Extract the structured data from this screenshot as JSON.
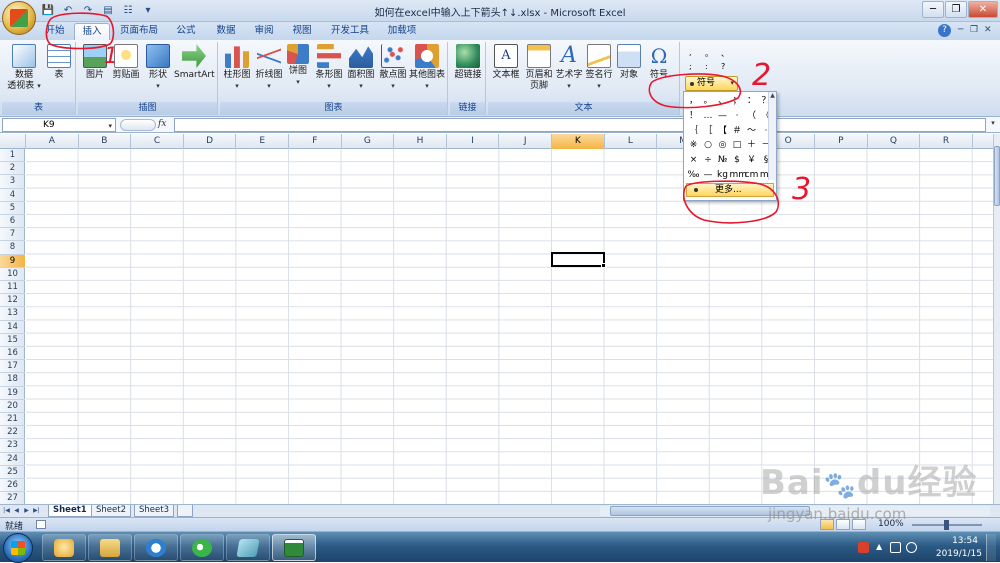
{
  "window": {
    "title": "如何在excel中输入上下箭头↑↓.xlsx - Microsoft Excel",
    "minimize": "─",
    "restore": "❐",
    "close": "✕",
    "quick_access": [
      "💾",
      "↶",
      "↷",
      "▤",
      "☷",
      "▾"
    ]
  },
  "tabs": [
    {
      "label": "开始",
      "active": false
    },
    {
      "label": "插入",
      "active": true
    },
    {
      "label": "页面布局",
      "active": false
    },
    {
      "label": "公式",
      "active": false
    },
    {
      "label": "数据",
      "active": false
    },
    {
      "label": "审阅",
      "active": false
    },
    {
      "label": "视图",
      "active": false
    },
    {
      "label": "开发工具",
      "active": false
    },
    {
      "label": "加载项",
      "active": false
    }
  ],
  "help_label": "?",
  "ribbon": {
    "groups": {
      "tables": "表",
      "illustrations": "插图",
      "charts": "图表",
      "links": "链接",
      "text": "文本"
    },
    "buttons": {
      "pivot_line1": "数据",
      "pivot_line2": "透视表",
      "table": "表",
      "picture": "图片",
      "clipart": "剪贴画",
      "shapes": "形状",
      "smartart": "SmartArt",
      "column": "柱形图",
      "line": "折线图",
      "pie": "饼图",
      "bar": "条形图",
      "area": "面积图",
      "scatter": "散点图",
      "other": "其他图表",
      "hyperlink": "超链接",
      "textbox": "文本框",
      "header_line1": "页眉和",
      "header_line2": "页脚",
      "wordart": "艺术字",
      "signature": "签名行",
      "object": "对象",
      "symbol": "符号"
    },
    "textbox_glyph": "A",
    "wordart_glyph": "A",
    "omega_glyph": "Ω",
    "dropdown_glyph": "▾"
  },
  "symbol_mini": [
    ",",
    "。",
    "、",
    ";",
    ":",
    "?"
  ],
  "symbol_button": {
    "label": "符号"
  },
  "symbol_panel": {
    "rows": [
      [
        "，",
        "。",
        "、",
        "；",
        "：",
        "？"
      ],
      [
        "！",
        "…",
        "—",
        "·",
        "（",
        "《"
      ],
      [
        "｛",
        "［",
        "【",
        "＃",
        "～",
        "·"
      ],
      [
        "※",
        "○",
        "◎",
        "□",
        "＋",
        "－"
      ],
      [
        "×",
        "÷",
        "№",
        "$",
        "￥",
        "§"
      ],
      [
        "‰",
        "—",
        "kg",
        "mm",
        "cm",
        "m²"
      ]
    ],
    "more_label": "更多...",
    "scroll_up": "▲",
    "scroll_down": "▼"
  },
  "formula_bar": {
    "name_box": "K9",
    "fx": "fx",
    "formula": ""
  },
  "columns": [
    "A",
    "B",
    "C",
    "D",
    "E",
    "F",
    "G",
    "H",
    "I",
    "J",
    "K",
    "L",
    "M",
    "N",
    "O",
    "P",
    "Q",
    "R"
  ],
  "selected_column": "K",
  "rows": [
    "1",
    "2",
    "3",
    "4",
    "5",
    "6",
    "7",
    "8",
    "9",
    "10",
    "11",
    "12",
    "13",
    "14",
    "15",
    "16",
    "17",
    "18",
    "19",
    "20",
    "21",
    "22",
    "23",
    "24",
    "25",
    "26",
    "27"
  ],
  "selected_row": "9",
  "sheets": [
    {
      "name": "Sheet1",
      "active": true
    },
    {
      "name": "Sheet2",
      "active": false
    },
    {
      "name": "Sheet3",
      "active": false
    }
  ],
  "sheet_nav": [
    "|◀",
    "◀",
    "▶",
    "▶|"
  ],
  "status": {
    "ready": "就绪",
    "zoom": "100%"
  },
  "clock": {
    "time": "13:54",
    "date": "2019/1/15"
  },
  "annotations": {
    "n1": "1",
    "n2": "2",
    "n3": "3",
    "color": "#e8162e"
  },
  "watermark": {
    "brand": "Bai",
    "brand2": "du",
    "cn": "经验",
    "url": "jingyan.baidu.com"
  }
}
